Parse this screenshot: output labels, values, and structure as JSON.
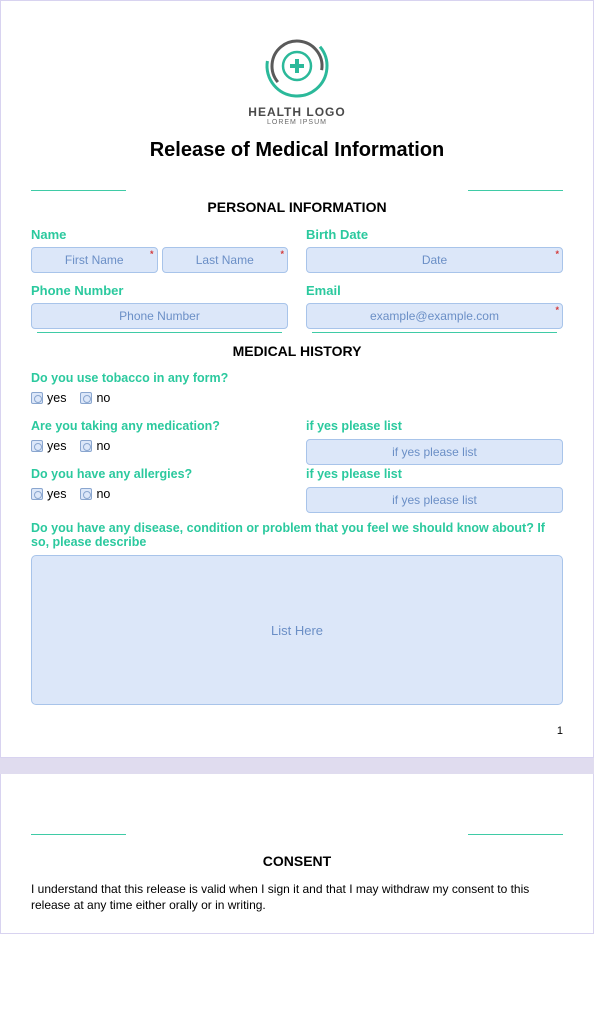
{
  "logo": {
    "text": "HEALTH LOGO",
    "sub": "LOREM IPSUM"
  },
  "title": "Release of Medical Information",
  "personal": {
    "heading": "PERSONAL INFORMATION",
    "name_label": "Name",
    "firstname_ph": "First Name",
    "lastname_ph": "Last Name",
    "birthdate_label": "Birth Date",
    "birthdate_ph": "Date",
    "phone_label": "Phone Number",
    "phone_ph": "Phone Number",
    "email_label": "Email",
    "email_ph": "example@example.com"
  },
  "medical": {
    "heading": "MEDICAL HISTORY",
    "q_tobacco": "Do you use tobacco in any form?",
    "q_medication": "Are you taking any medication?",
    "q_medication_list": "if yes please list",
    "medication_list_ph": "if yes please list",
    "q_allergies": "Do you have any allergies?",
    "q_allergies_list": "if yes please list",
    "allergies_list_ph": "if yes please list",
    "q_disease": "Do you have any disease, condition or problem that you feel we should know about? If so, please describe",
    "disease_ph": "List Here",
    "opt_yes": "yes",
    "opt_no": "no"
  },
  "page_number": "1",
  "consent": {
    "heading": "CONSENT",
    "text": "I understand that this release is valid when I sign it and that I may withdraw my consent to this release at any time either orally or in writing."
  }
}
